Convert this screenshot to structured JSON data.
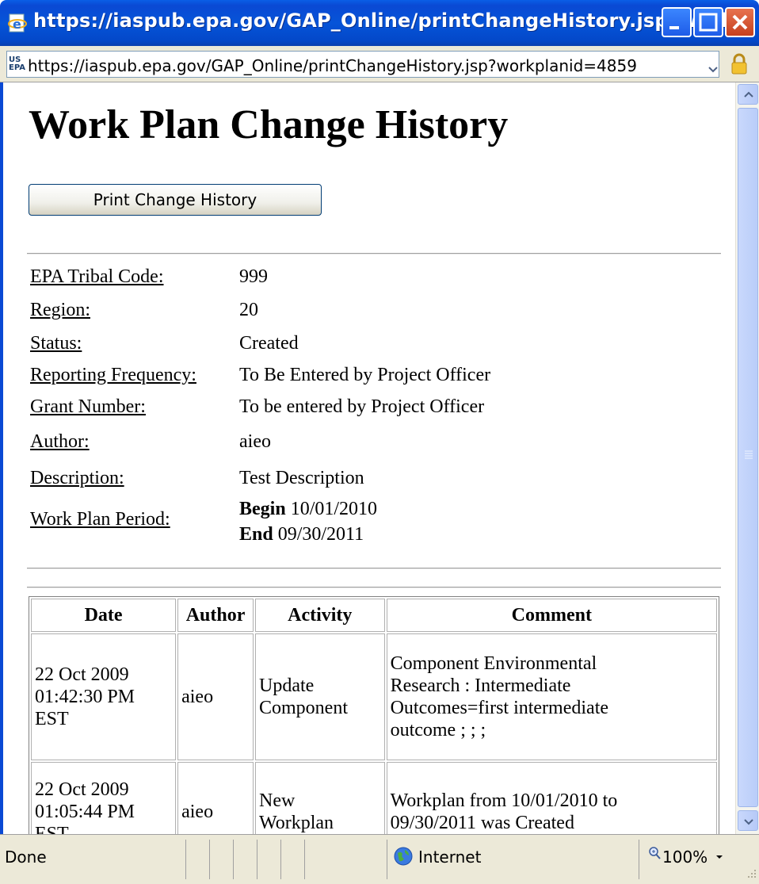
{
  "window": {
    "title": "https://iaspub.epa.gov/GAP_Online/printChangeHistory.jsp?work...",
    "accent_color": "#0a49d4"
  },
  "addressbar": {
    "logo_text": "US EPA",
    "url": "https://iaspub.epa.gov/GAP_Online/printChangeHistory.jsp?workplanid=4859"
  },
  "page": {
    "title": "Work Plan Change History",
    "print_button": "Print Change History"
  },
  "info": {
    "tribal_code": {
      "label": "EPA Tribal Code:",
      "value": "999"
    },
    "region": {
      "label": "Region:",
      "value": "20"
    },
    "status": {
      "label": "Status:",
      "value": "Created"
    },
    "reporting_frequency": {
      "label": "Reporting Frequency:",
      "value": "To Be Entered by Project Officer"
    },
    "grant_number": {
      "label": "Grant Number:",
      "value": "To be entered by Project Officer"
    },
    "author": {
      "label": "Author:",
      "value": "aieo"
    },
    "description": {
      "label": "Description:",
      "value": "Test Description"
    },
    "period": {
      "label": "Work Plan Period:",
      "begin_label": "Begin",
      "begin_value": "10/01/2010",
      "end_label": "End",
      "end_value": "09/30/2011"
    }
  },
  "history": {
    "headers": [
      "Date",
      "Author",
      "Activity",
      "Comment"
    ],
    "rows": [
      {
        "date_line1": "22 Oct 2009",
        "date_line2": "01:42:30 PM",
        "date_line3": "EST",
        "author": "aieo",
        "activity_line1": "Update",
        "activity_line2": "Component",
        "comment_line1": "Component Environmental",
        "comment_line2": "Research : Intermediate",
        "comment_line3": "Outcomes=first intermediate",
        "comment_line4": "outcome ; ; ;"
      },
      {
        "date_line1": "22 Oct 2009",
        "date_line2": "01:05:44 PM",
        "date_line3": "EST",
        "author": "aieo",
        "activity_line1": "New",
        "activity_line2": "Workplan",
        "comment_line1": "Workplan from 10/01/2010 to",
        "comment_line2": "09/30/2011 was Created"
      }
    ]
  },
  "statusbar": {
    "status": "Done",
    "zone": "Internet",
    "zoom": "100%"
  },
  "icons": {
    "title_icon": "ie-page-icon",
    "lock": "lock-icon",
    "zone": "globe-icon",
    "zoom": "magnifier-icon"
  }
}
